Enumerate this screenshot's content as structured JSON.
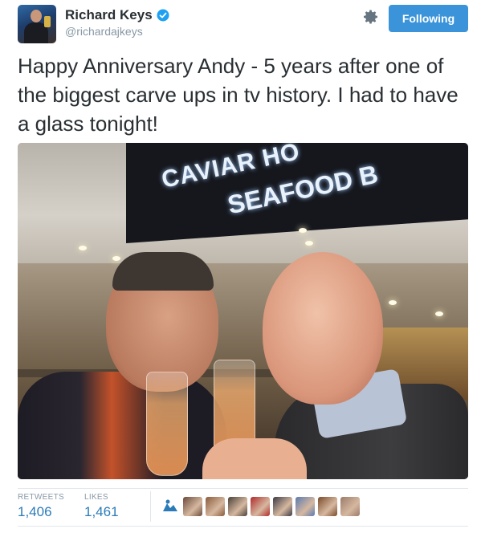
{
  "user": {
    "display_name": "Richard Keys",
    "handle": "@richardajkeys",
    "verified": true
  },
  "actions": {
    "follow_label": "Following",
    "settings_icon": "gear-icon"
  },
  "tweet": {
    "text": "Happy Anniversary Andy - 5 years after one of the biggest carve ups in tv history. I had to have a glass tonight!",
    "photo_sign_line1": "CAVIAR HO",
    "photo_sign_line2": "SEAFOOD B"
  },
  "stats": {
    "retweets_label": "RETWEETS",
    "retweets_count": "1,406",
    "likes_label": "LIKES",
    "likes_count": "1,461"
  },
  "likers": [
    {
      "name": "liker-1",
      "color": "#ffffff",
      "accent": "#2b7bb9"
    },
    {
      "name": "liker-2",
      "color": "#6a4a3a"
    },
    {
      "name": "liker-3",
      "color": "#8a5a3a"
    },
    {
      "name": "liker-4",
      "color": "#4a4038"
    },
    {
      "name": "liker-5",
      "color": "#b02a2a"
    },
    {
      "name": "liker-6",
      "color": "#3a3a44"
    },
    {
      "name": "liker-7",
      "color": "#5a7ab0"
    },
    {
      "name": "liker-8",
      "color": "#7a4a2a"
    },
    {
      "name": "liker-9",
      "color": "#9a7a6a"
    }
  ],
  "colors": {
    "accent": "#3b94d9",
    "link": "#2b7bb9",
    "muted": "#8899a6",
    "verified": "#1da1f2"
  }
}
